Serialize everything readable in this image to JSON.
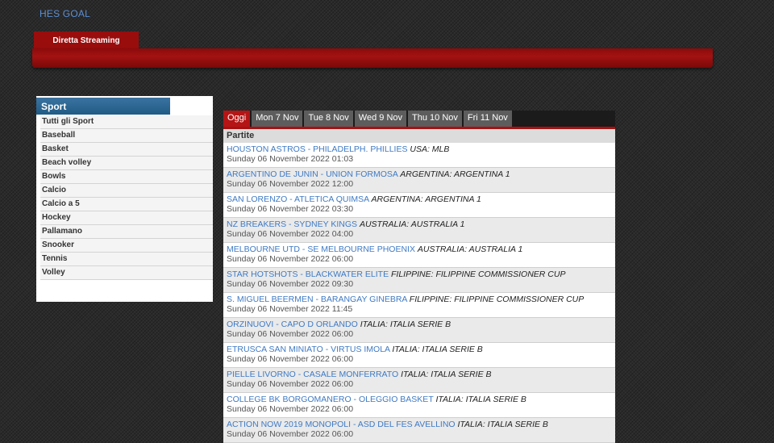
{
  "header": {
    "brand": "HES GOAL",
    "main_tab": "Diretta Streaming"
  },
  "sidebar": {
    "title": "Sport",
    "items": [
      "Tutti gli Sport",
      "Baseball",
      "Basket",
      "Beach volley",
      "Bowls",
      "Calcio",
      "Calcio a 5",
      "Hockey",
      "Pallamano",
      "Snooker",
      "Tennis",
      "Volley"
    ]
  },
  "days": {
    "active_index": 0,
    "tabs": [
      "Oggi",
      "Mon 7 Nov",
      "Tue 8 Nov",
      "Wed 9 Nov",
      "Thu 10 Nov",
      "Fri 11 Nov"
    ]
  },
  "table": {
    "header": "Partite",
    "matches": [
      {
        "teams": "HOUSTON ASTROS - PHILADELPH. PHILLIES",
        "league": "USA: MLB",
        "date": "Sunday 06 November 2022 01:03"
      },
      {
        "teams": "ARGENTINO DE JUNIN - UNION FORMOSA",
        "league": "ARGENTINA: ARGENTINA 1",
        "date": "Sunday 06 November 2022 12:00"
      },
      {
        "teams": "SAN LORENZO - ATLETICA QUIMSA",
        "league": "ARGENTINA: ARGENTINA 1",
        "date": "Sunday 06 November 2022 03:30"
      },
      {
        "teams": "NZ BREAKERS - SYDNEY KINGS",
        "league": "AUSTRALIA: AUSTRALIA 1",
        "date": "Sunday 06 November 2022 04:00"
      },
      {
        "teams": "MELBOURNE UTD - SE MELBOURNE PHOENIX",
        "league": "AUSTRALIA: AUSTRALIA 1",
        "date": "Sunday 06 November 2022 06:00"
      },
      {
        "teams": "STAR HOTSHOTS - BLACKWATER ELITE",
        "league": "FILIPPINE: FILIPPINE COMMISSIONER CUP",
        "date": "Sunday 06 November 2022 09:30"
      },
      {
        "teams": "S. MIGUEL BEERMEN - BARANGAY GINEBRA",
        "league": "FILIPPINE: FILIPPINE COMMISSIONER CUP",
        "date": "Sunday 06 November 2022 11:45"
      },
      {
        "teams": "ORZINUOVI - CAPO D ORLANDO",
        "league": "ITALIA: ITALIA SERIE B",
        "date": "Sunday 06 November 2022 06:00"
      },
      {
        "teams": "ETRUSCA SAN MINIATO - VIRTUS IMOLA",
        "league": "ITALIA: ITALIA SERIE B",
        "date": "Sunday 06 November 2022 06:00"
      },
      {
        "teams": "PIELLE LIVORNO - CASALE MONFERRATO",
        "league": "ITALIA: ITALIA SERIE B",
        "date": "Sunday 06 November 2022 06:00"
      },
      {
        "teams": "COLLEGE BK BORGOMANERO - OLEGGIO BASKET",
        "league": "ITALIA: ITALIA SERIE B",
        "date": "Sunday 06 November 2022 06:00"
      },
      {
        "teams": "ACTION NOW 2019 MONOPOLI - ASD DEL FES AVELLINO",
        "league": "ITALIA: ITALIA SERIE B",
        "date": "Sunday 06 November 2022 06:00"
      }
    ]
  },
  "colors": {
    "accent_red": "#a61111",
    "link_blue": "#3f7ac4",
    "sidebar_head": "#1f5b85"
  }
}
